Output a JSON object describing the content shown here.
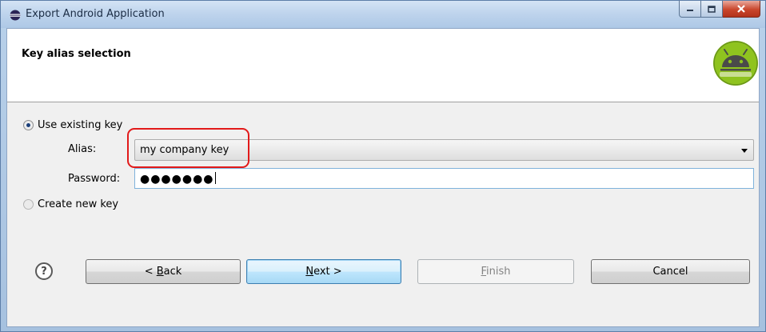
{
  "window": {
    "title": "Export Android Application"
  },
  "header": {
    "title": "Key alias selection"
  },
  "options": {
    "use_existing": "Use existing key",
    "create_new": "Create new key"
  },
  "fields": {
    "alias_label": "Alias:",
    "alias_value": "my company key",
    "password_label": "Password:",
    "password_value": "●●●●●●●"
  },
  "buttons": {
    "help": "?",
    "back": {
      "pre": "< ",
      "mnemonic": "B",
      "post": "ack"
    },
    "next": {
      "pre": "",
      "mnemonic": "N",
      "post": "ext >"
    },
    "finish": {
      "pre": "",
      "mnemonic": "F",
      "post": "inish"
    },
    "cancel": "Cancel"
  },
  "icons": {
    "app": "eclipse-icon",
    "wizard_banner": "android-robot-icon",
    "help": "help-icon"
  },
  "colors": {
    "annotation_red": "#e21a1a",
    "android_green": "#8fc31f",
    "focus_blue": "#7fb2db"
  }
}
